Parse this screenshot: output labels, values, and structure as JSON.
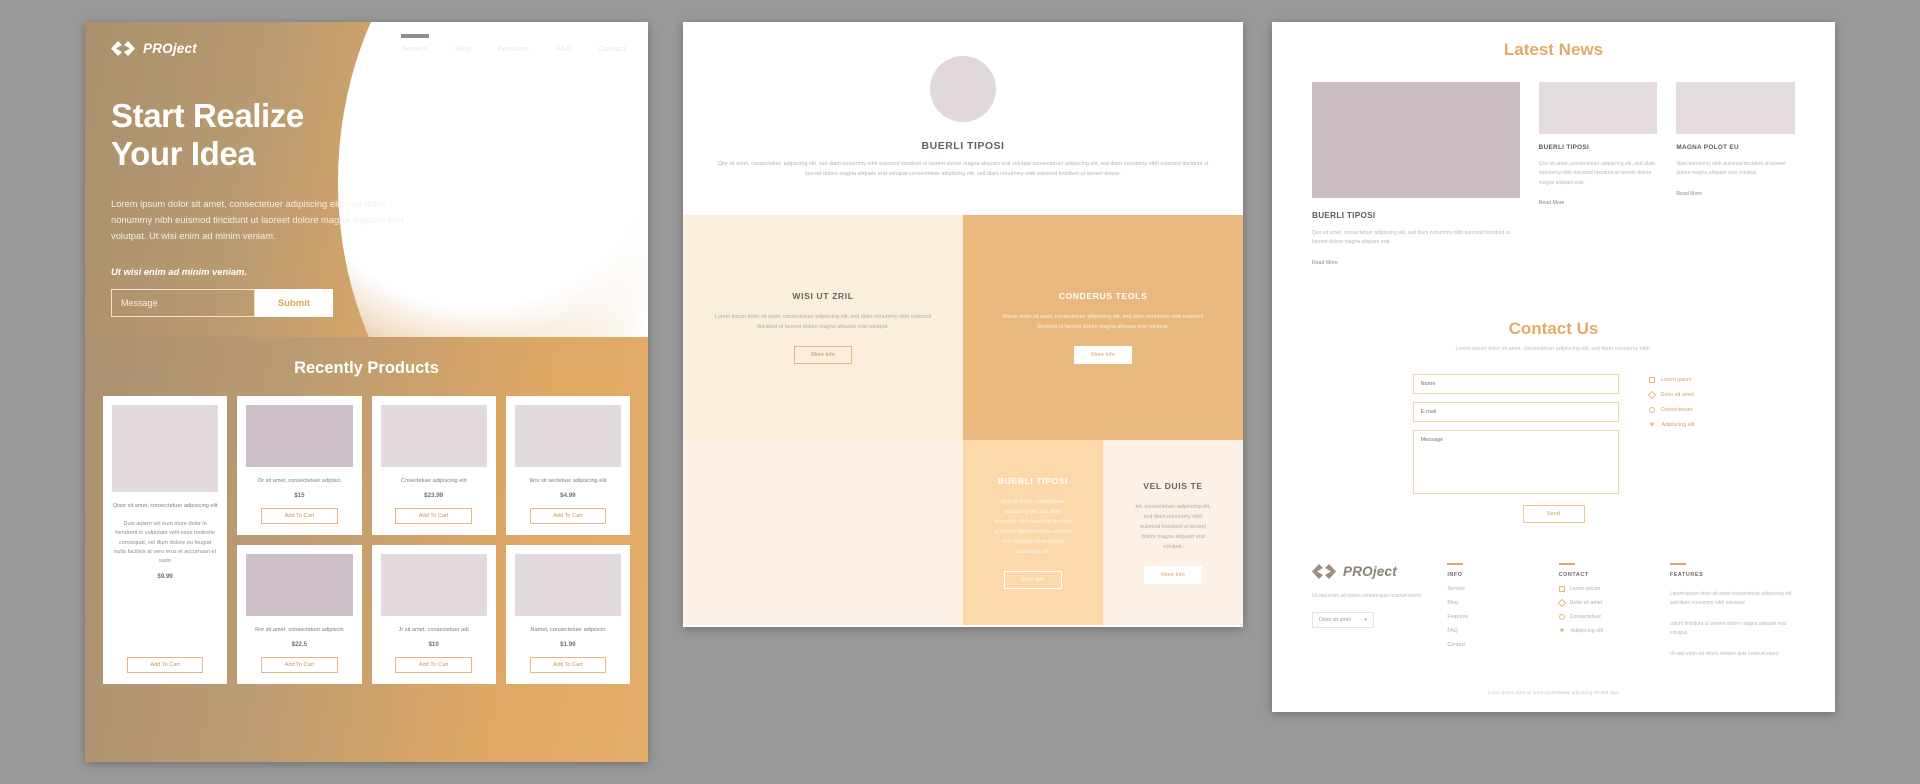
{
  "brand": {
    "name_bold": "PRO",
    "name_light": "ject",
    "icon": "code-brackets-icon"
  },
  "nav": {
    "items": [
      "Service",
      "Blog",
      "Features",
      "FAQ",
      "Contact"
    ],
    "active_index": 0
  },
  "hero": {
    "title_line1": "Start Realize",
    "title_line2": "Your Idea",
    "paragraph": "Lorem ipsum dolor sit amet, consectetuer adipiscing elit, sed diam nonummy nibh euismod tincidunt ut laoreet dolore magna aliquam erat volutpat. Ut wisi enim ad minim veniam.",
    "emphasis": "Ut wisi enim ad minim veniam.",
    "input_placeholder": "Message",
    "submit_label": "Submit"
  },
  "products": {
    "title": "Recently Products",
    "cart_label": "Add To Cart",
    "featured": {
      "name": "Qisor sit amet, consectetuer adipiscing elit",
      "desc": "Duis autem vel eum iriure dolor in hendrerit in vulputate velit esse molestie consequat, vel illum dolore eu feugiat nulla facilisis at vero eros et accumsan et iusto",
      "price": "$9.99"
    },
    "items": [
      {
        "name": "Dr sit amet, consectetuer adipisci",
        "price": "$15"
      },
      {
        "name": "Cnsectetuer adipiscing elit",
        "price": "$23.99"
      },
      {
        "name": "Wor sit sectetuer adipiscing elit",
        "price": "$4.99"
      },
      {
        "name": "Ror sit amet, consectetuer adipiscin",
        "price": "$22.5"
      },
      {
        "name": "Jr sit amet, consectetuer adi",
        "price": "$10"
      },
      {
        "name": "Namet, consectetuer adipiscin",
        "price": "$1.99"
      }
    ]
  },
  "features": {
    "hero": {
      "title": "BUERLI TIPOSI",
      "paragraph": "Qior sit amet, consectetuer adipiscing elit, sed diam nonummy nibh euismod tincidunt ut laoreet dolore magna aliquam erat volutpat consectetuer adipiscing elit, sed diam nonummy nibh euismod tincidunt ut laoreet dolore magna aliquam erat volutpat consectetuer adipiscing elit, sed diam nonummy nibh euismod tincidunt ut laoreet dolore."
    },
    "cells": [
      {
        "title": "WISI UT ZRIL",
        "text": "Lorem ipsum dolor sit amet, consectetuer adipiscing elit, sed diam nonummy nibh euismod tincidunt ut laoreet dolore magna aliquam erat volutpat.",
        "button": "More Info"
      },
      {
        "title": "CONDERUS TEOLS",
        "text": "Wsum dolor sit amet, consectetuer adipiscing elit, sed diam nonummy nibh euismod tincidunt ut laoreet dolore magna aliquam erat volutpat.",
        "button": "More Info"
      },
      {
        "title": "BUERLI TIPOSI",
        "text": "Qlut sit amet, consectetuer adipiscing elit, sed diam nonummy nibh euismod tincidunt ut laoreet dolore magna aliquam erat volutpat consectetuer adipiscing elit.",
        "button": "More Info"
      },
      {
        "title": "VEL DUIS TE",
        "text": "Iet, consectetuer adipiscing elit, sed diam nonummy nibh euismod tincidunt ut laoreet dolore magna aliquam erat volutpat.",
        "button": "More Info"
      }
    ]
  },
  "news": {
    "title": "Latest News",
    "read_more": "Read More",
    "featured": {
      "title": "BUERLI TIPOSI",
      "text": "Qior sit amet, consectetuer adipiscing elit, sed diam nonummy nibh euismod tincidunt ut laoreet dolore magna aliquam erat."
    },
    "items": [
      {
        "title": "BUERLI TIPOSI",
        "text": "Qior sit amet, consectetuer adipiscing elit, sed diam nonummy nibh euismod tincidunt ut laoreet dolore magna aliquam erat."
      },
      {
        "title": "MAGNA POLOT EU",
        "text": "Nam nonummy nibh euismod tincidunt ut laoreet dolore magna aliquam erat volutpat."
      }
    ]
  },
  "contact": {
    "title": "Contact Us",
    "subtitle": "Lorem ipsum dolor sit amet, consectetuer adipiscing elit, sed diam nonummy nibh.",
    "fields": {
      "name_placeholder": "Name",
      "email_placeholder": "E-mail",
      "message_placeholder": "Message"
    },
    "options": [
      {
        "label": "Lorem ipsum",
        "marker": "square-checkbox-icon"
      },
      {
        "label": "Dolor sit amet",
        "marker": "diamond-radio-icon"
      },
      {
        "label": "Consectetuer",
        "marker": "circle-radio-icon"
      },
      {
        "label": "Adipiscing elit",
        "marker": "star-selected-icon"
      }
    ],
    "send_label": "Send"
  },
  "footer": {
    "about": "Ut wisi enim ad minim veniam quis nostrud exerci",
    "lang_select": "Dolor sit amet",
    "columns": [
      {
        "head": "INFO",
        "links": [
          "Service",
          "Blog",
          "Features",
          "FAQ",
          "Contact"
        ]
      },
      {
        "head": "CONTACT",
        "options": [
          {
            "label": "Lorem ipsum",
            "marker": "square-checkbox-icon"
          },
          {
            "label": "Dolor sit amet",
            "marker": "diamond-radio-icon"
          },
          {
            "label": "Consectetuer",
            "marker": "circle-radio-icon"
          },
          {
            "label": "Adipiscing elit",
            "marker": "star-selected-icon"
          }
        ]
      },
      {
        "head": "FEATURES",
        "text1": "Lorem ipsum dolor sit amet consectetuer adipiscing elit sed diam nonummy nibh euismod",
        "text2": "cidunt tincidunt ut laoreet dolore magna aliquam erat volutpat",
        "text3": "Ut wisi enim ad minim veniam quis nostrud exerci"
      }
    ],
    "copyright": "Lorem ipsum dolor sit amet consectetuer adipiscing elit sed diam"
  },
  "colors": {
    "accent": "#e0ac66",
    "tan": "#e8b87f",
    "cream": "#fbeedd",
    "peach": "#fdd8ab",
    "muted": "#b9b2ab",
    "backdrop": "#9a9a9a"
  }
}
